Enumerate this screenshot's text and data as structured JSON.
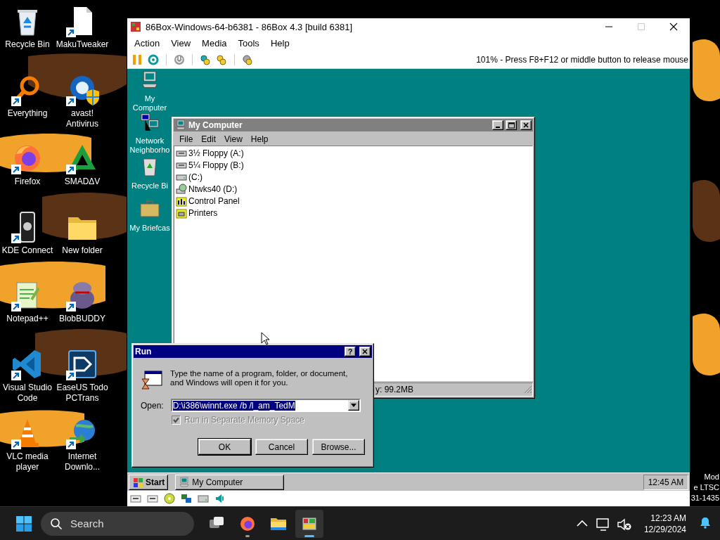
{
  "desktop_icons": [
    {
      "label": "Recycle Bin",
      "kind": "recycle",
      "shortcut": false
    },
    {
      "label": "MakuTweaker",
      "kind": "document",
      "shortcut": true
    },
    {
      "label": "Everything",
      "kind": "everything",
      "shortcut": true
    },
    {
      "label": "avast! Antivirus",
      "kind": "avast",
      "shortcut": true
    },
    {
      "label": "Firefox",
      "kind": "firefox",
      "shortcut": true
    },
    {
      "label": "SMADΔV",
      "kind": "smadav",
      "shortcut": true
    },
    {
      "label": "KDE Connect",
      "kind": "kde",
      "shortcut": true
    },
    {
      "label": "New folder",
      "kind": "folder",
      "shortcut": false
    },
    {
      "label": "Notepad++",
      "kind": "notepad",
      "shortcut": true
    },
    {
      "label": "BlobBUDDY",
      "kind": "blob",
      "shortcut": true
    },
    {
      "label": "Visual Studio Code",
      "kind": "vscode",
      "shortcut": true
    },
    {
      "label": "EaseUS Todo PCTrans",
      "kind": "easeus",
      "shortcut": true
    },
    {
      "label": "VLC media player",
      "kind": "vlc",
      "shortcut": true
    },
    {
      "label": "Internet Downlo...",
      "kind": "idm",
      "shortcut": true
    }
  ],
  "desktop_edge_texts": [
    "Mod",
    "e LTSC",
    "31-1435"
  ],
  "emulator": {
    "title": "86Box-Windows-64-b6381 - 86Box 4.3 [build 6381]",
    "menu": [
      "Action",
      "View",
      "Media",
      "Tools",
      "Help"
    ],
    "toolbar": [
      [
        {
          "kind": "pause"
        },
        {
          "kind": "reset"
        }
      ],
      [
        {
          "kind": "power"
        }
      ],
      [
        {
          "kind": "ctrl-alt-del"
        },
        {
          "kind": "ctrl-alt-esc"
        }
      ],
      [
        {
          "kind": "settings"
        }
      ]
    ],
    "status": "101% - Press F8+F12 or middle button to release mouse",
    "status_icons": [
      {
        "kind": "floppy"
      },
      {
        "kind": "floppy"
      },
      {
        "kind": "cdrom"
      },
      {
        "kind": "network"
      },
      {
        "kind": "hdd"
      },
      {
        "kind": "sound"
      }
    ]
  },
  "guest": {
    "desktop_icons": [
      {
        "label": "My Computer",
        "kind": "computer"
      },
      {
        "label": "Network Neighborho",
        "kind": "network"
      },
      {
        "label": "Recycle Bi",
        "kind": "recycle"
      },
      {
        "label": "My Briefcas",
        "kind": "briefcase"
      }
    ],
    "my_computer": {
      "title": "My Computer",
      "active": false,
      "menu": [
        "File",
        "Edit",
        "View",
        "Help"
      ],
      "items": [
        {
          "label": "3½ Floppy (A:)",
          "kind": "floppy"
        },
        {
          "label": "5¼ Floppy (B:)",
          "kind": "floppy"
        },
        {
          "label": "(C:)",
          "kind": "hdd"
        },
        {
          "label": "Ntwks40 (D:)",
          "kind": "cdrom"
        },
        {
          "label": "Control Panel",
          "kind": "control-panel"
        },
        {
          "label": "Printers",
          "kind": "printers"
        }
      ],
      "status": "y: 99.2MB"
    },
    "run_dialog": {
      "title": "Run",
      "active": true,
      "help_button": "?",
      "prompt": "Type the name of a program, folder, or document, and Windows will open it for you.",
      "open_label": "Open:",
      "command": "D:\\i386\\winnt.exe /b /l_am_TedM",
      "option": {
        "label": "Run in Separate Memory Space",
        "checked": true,
        "disabled": true
      },
      "buttons": [
        {
          "label": "OK",
          "default": true
        },
        {
          "label": "Cancel",
          "default": false
        },
        {
          "label": "Browse...",
          "default": false
        }
      ]
    },
    "taskbar": {
      "start": "Start",
      "tasks": [
        {
          "label": "My Computer",
          "selected": false
        }
      ],
      "clock": "12:45 AM"
    }
  },
  "taskbar": {
    "search": {
      "placeholder": "Search"
    },
    "apps": [
      {
        "kind": "task-view",
        "selected": false,
        "running": false
      },
      {
        "kind": "firefox",
        "selected": false,
        "running": true
      },
      {
        "kind": "explorer",
        "selected": false,
        "running": false
      },
      {
        "kind": "emulator",
        "selected": true,
        "running": true
      }
    ],
    "tray": [
      {
        "kind": "chevron"
      },
      {
        "kind": "network"
      },
      {
        "kind": "volume"
      }
    ],
    "time": "12:23 AM",
    "date": "12/29/2024"
  }
}
